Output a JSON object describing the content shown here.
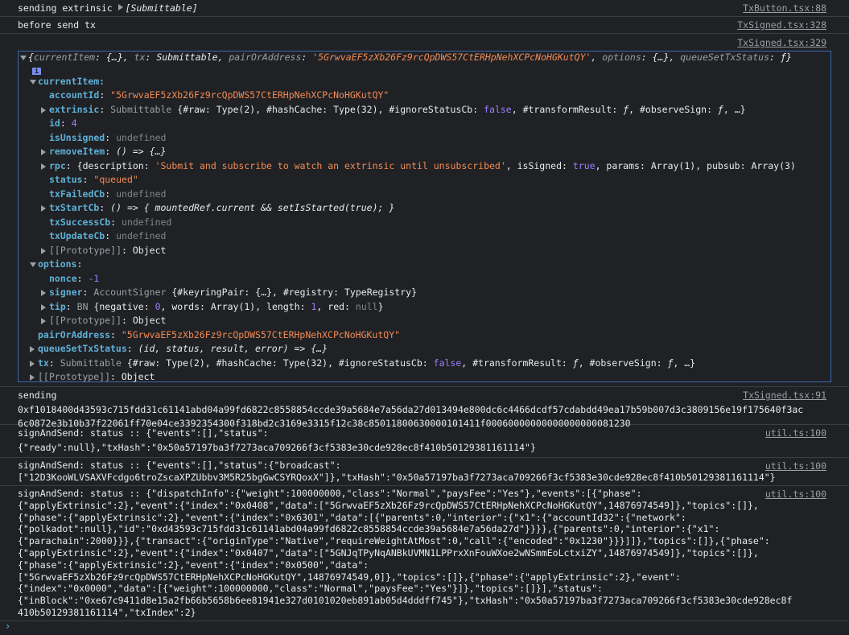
{
  "messages": {
    "m1": {
      "text": "sending extrinsic ",
      "value": "[Submittable]",
      "source": "TxButton.tsx:88"
    },
    "m2": {
      "text": "before send tx",
      "source": "TxSigned.tsx:328"
    },
    "m3": {
      "source": "TxSigned.tsx:329"
    },
    "m4": {
      "source": "TxSigned.tsx:91",
      "text": "sending\n0xf1018400d43593c715fdd31c61141abd04a99fd6822c8558854ccde39a5684e7a56da27d013494e800dc6c4466dcdf57cdabdd49ea17b59b007d3c3809156e19f175640f3ac6c0872e3b10b37f22061ff70e04ce3392354300f318bd2c3169e3315f12c38c85011800630000101411f00060000000000000000081230"
    },
    "m5": {
      "source": "util.ts:100",
      "text": "signAndSend: status :: {\"events\":[],\"status\":\n{\"ready\":null},\"txHash\":\"0x50a57197ba3f7273aca709266f3cf5383e30cde928ec8f410b50129381161114\"}"
    },
    "m6": {
      "source": "util.ts:100",
      "text": "signAndSend: status :: {\"events\":[],\"status\":{\"broadcast\":\n[\"12D3KooWLVSAXVFcdgo6troZscaXPZUbbv3M5R25bgGwCSYRQoxX\"]},\"txHash\":\"0x50a57197ba3f7273aca709266f3cf5383e30cde928ec8f410b50129381161114\"}"
    },
    "m7": {
      "source": "util.ts:100",
      "text": "signAndSend: status :: {\"dispatchInfo\":{\"weight\":100000000,\"class\":\"Normal\",\"paysFee\":\"Yes\"},\"events\":[{\"phase\":\n{\"applyExtrinsic\":2},\"event\":{\"index\":\"0x0408\",\"data\":[\"5GrwvaEF5zXb26Fz9rcQpDWS57CtERHpNehXCPcNoHGKutQY\",14876974549]},\"topics\":[]},\n{\"phase\":{\"applyExtrinsic\":2},\"event\":{\"index\":\"0x6301\",\"data\":[{\"parents\":0,\"interior\":{\"x1\":{\"accountId32\":{\"network\":\n{\"polkadot\":null},\"id\":\"0xd43593c715fdd31c61141abd04a99fd6822c8558854ccde39a5684e7a56da27d\"}}}},{\"parents\":0,\"interior\":{\"x1\":\n{\"parachain\":2000}}},{\"transact\":{\"originType\":\"Native\",\"requireWeightAtMost\":0,\"call\":{\"encoded\":\"0x1230\"}}}]]},\"topics\":[]},{\"phase\":\n{\"applyExtrinsic\":2},\"event\":{\"index\":\"0x0407\",\"data\":[\"5GNJqTPyNqANBkUVMN1LPPrxXnFouWXoe2wNSmmEoLctxiZY\",14876974549]},\"topics\":[]},\n{\"phase\":{\"applyExtrinsic\":2},\"event\":{\"index\":\"0x0500\",\"data\":\n[\"5GrwvaEF5zXb26Fz9rcQpDWS57CtERHpNehXCPcNoHGKutQY\",14876974549,0]},\"topics\":[]},{\"phase\":{\"applyExtrinsic\":2},\"event\":\n{\"index\":\"0x0000\",\"data\":[{\"weight\":100000000,\"class\":\"Normal\",\"paysFee\":\"Yes\"}]},\"topics\":[]}],\"status\":\n{\"inBlock\":\"0xe67c9411d8e15a2fb66b5658b6ee81941e327d0101020eb891ab05d4dddff745\"},\"txHash\":\"0x50a57197ba3f7273aca709266f3cf5383e30cde928ec8f\n410b50129381161114\",\"txIndex\":2}"
    }
  },
  "obj": {
    "summary_open": "{",
    "summary_currentItem": "currentItem",
    "summary_currentItem_val": "{…}",
    "summary_tx": "tx",
    "summary_tx_val": "Submittable",
    "summary_pair": "pairOrAddress",
    "summary_pair_val": "'5GrwvaEF5zXb26Fz9rcQpDWS57CtERHpNehXCPcNoHGKutQY'",
    "summary_options": "options",
    "summary_options_val": "{…}",
    "summary_queue": "queueSetTxStatus",
    "summary_queue_val": "ƒ}",
    "info_badge": "i",
    "currentItem_label": "currentItem:",
    "accountId_key": "accountId",
    "accountId_val": "\"5GrwvaEF5zXb26Fz9rcQpDWS57CtERHpNehXCPcNoHGKutQY\"",
    "extrinsic_key": "extrinsic",
    "extrinsic_type": "Submittable ",
    "extrinsic_p1": "{#raw: ",
    "extrinsic_p1v": "Type(2)",
    "extrinsic_p2": ", #hashCache: ",
    "extrinsic_p2v": "Type(32)",
    "extrinsic_p3": ", #ignoreStatusCb: ",
    "extrinsic_p3v": "false",
    "extrinsic_p4": ", #transformResult: ",
    "extrinsic_p4v": "ƒ",
    "extrinsic_p5": ", #observeSign: ",
    "extrinsic_p5v": "ƒ",
    "extrinsic_p6": ", …}",
    "id_key": "id",
    "id_val": "4",
    "isUnsigned_key": "isUnsigned",
    "isUnsigned_val": "undefined",
    "removeItem_key": "removeItem",
    "removeItem_val": "() => {…}",
    "rpc_key": "rpc",
    "rpc_p1": "{description: ",
    "rpc_p1v": "'Submit and subscribe to watch an extrinsic until unsubscribed'",
    "rpc_p2": ", isSigned: ",
    "rpc_p2v": "true",
    "rpc_p3": ", params: ",
    "rpc_p3v": "Array(1)",
    "rpc_p4": ", pubsub: ",
    "rpc_p4v": "Array(3)",
    "status_key": "status",
    "status_val": "\"queued\"",
    "txFailedCb_key": "txFailedCb",
    "txFailedCb_val": "undefined",
    "txStartCb_key": "txStartCb",
    "txStartCb_val": "() => { mountedRef.current && setIsStarted(true); }",
    "txSuccessCb_key": "txSuccessCb",
    "txSuccessCb_val": "undefined",
    "txUpdateCb_key": "txUpdateCb",
    "txUpdateCb_val": "undefined",
    "proto_key": "[[Prototype]]",
    "proto_val": "Object",
    "options_label": "options:",
    "nonce_key": "nonce",
    "nonce_val": "-1",
    "signer_key": "signer",
    "signer_type": "AccountSigner ",
    "signer_p1": "{#keyringPair: ",
    "signer_p1v": "{…}",
    "signer_p2": ", #registry: ",
    "signer_p2v": "TypeRegistry",
    "signer_p3": "}",
    "tip_key": "tip",
    "tip_type": "BN ",
    "tip_p1": "{negative: ",
    "tip_p1v": "0",
    "tip_p2": ", words: ",
    "tip_p2v": "Array(1)",
    "tip_p3": ", length: ",
    "tip_p3v": "1",
    "tip_p4": ", red: ",
    "tip_p4v": "null",
    "tip_p5": "}",
    "pair_key": "pairOrAddress",
    "pair_val": "\"5GrwvaEF5zXb26Fz9rcQpDWS57CtERHpNehXCPcNoHGKutQY\"",
    "queue_key": "queueSetTxStatus",
    "queue_val": "(id, status, result, error) => {…}",
    "tx_key": "tx",
    "tx_type": "Submittable ",
    "tx_p1": "{#raw: ",
    "tx_p1v": "Type(2)",
    "tx_p2": ", #hashCache: ",
    "tx_p2v": "Type(32)",
    "tx_p3": ", #ignoreStatusCb: ",
    "tx_p3v": "false",
    "tx_p4": ", #transformResult: ",
    "tx_p4v": "ƒ",
    "tx_p5": ", #observeSign: ",
    "tx_p5v": "ƒ",
    "tx_p6": ", …}",
    "root_proto_key": "[[Prototype]]",
    "root_proto_val": "Object"
  },
  "prompt_symbol": "›"
}
